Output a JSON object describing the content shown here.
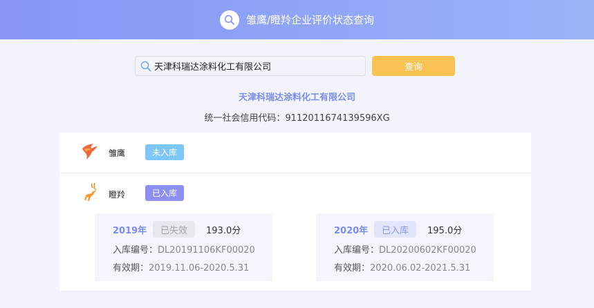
{
  "header": {
    "title": "雏鹰/瞪羚企业评价状态查询"
  },
  "search": {
    "value": "天津科瑞达涂料化工有限公司",
    "button_label": "查询"
  },
  "result": {
    "company_name": "天津科瑞达涂料化工有限公司",
    "credit_code_label": "统一社会信用代码：",
    "credit_code": "9112011674139596XG"
  },
  "categories": [
    {
      "label": "雏鹰",
      "status": "未入库",
      "icon": "eagle-icon"
    },
    {
      "label": "瞪羚",
      "status": "已入库",
      "icon": "gazelle-icon"
    }
  ],
  "records": [
    {
      "year": "2019年",
      "status": "已失效",
      "score": "193.0分",
      "number_label": "入库编号：",
      "number": "DL20191106KF00020",
      "validity_label": "有效期：",
      "validity": "2019.11.06-2020.5.31"
    },
    {
      "year": "2020年",
      "status": "已入库",
      "score": "195.0分",
      "number_label": "入库编号：",
      "number": "DL20200602KF00020",
      "validity_label": "有效期：",
      "validity": "2020.06.02-2021.5.31"
    }
  ],
  "colors": {
    "header_gradient_start": "#8794f6",
    "header_gradient_end": "#9ab4f7",
    "accent": "#7a8df0",
    "button": "#fac253",
    "tag_not_in": "#7cc7f7",
    "tag_in": "#8e8ff2"
  }
}
